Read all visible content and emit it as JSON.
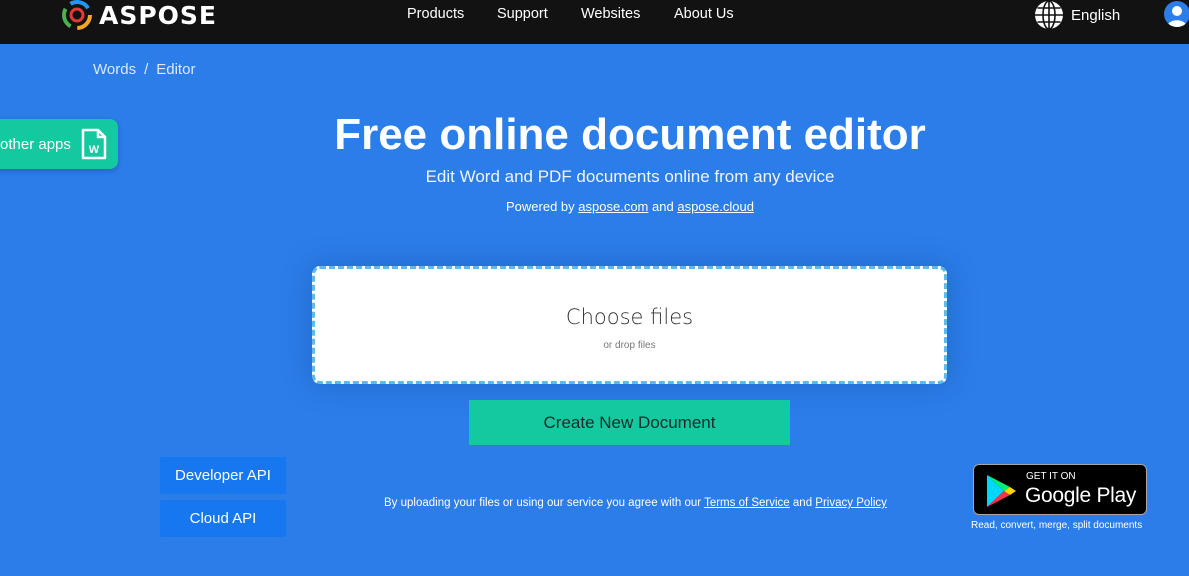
{
  "header": {
    "brand": "ASPOSE",
    "nav": [
      "Products",
      "Support",
      "Websites",
      "About Us"
    ],
    "language": "English"
  },
  "breadcrumb": {
    "items": [
      "Words",
      "Editor"
    ],
    "separator": "/"
  },
  "other_apps": {
    "label": "other apps"
  },
  "hero": {
    "title": "Free online document editor",
    "subtitle": "Edit Word and PDF documents online from any device",
    "powered_prefix": "Powered by",
    "powered_link1": "aspose.com",
    "powered_and": "and",
    "powered_link2": "aspose.cloud"
  },
  "upload": {
    "main": "Choose files",
    "sub": "or drop files"
  },
  "create_button": "Create New Document",
  "api": {
    "developer": "Developer API",
    "cloud": "Cloud API"
  },
  "terms": {
    "prefix": "By uploading your files or using our service you agree with our",
    "tos": "Terms of Service",
    "and": "and",
    "privacy": "Privacy Policy"
  },
  "google_play": {
    "small": "GET IT ON",
    "big": "Google Play",
    "caption": "Read, convert, merge, split documents"
  },
  "colors": {
    "background": "#2b7de9",
    "topbar": "#121212",
    "accent_green": "#14c9a0",
    "api_blue": "#1677f1"
  }
}
